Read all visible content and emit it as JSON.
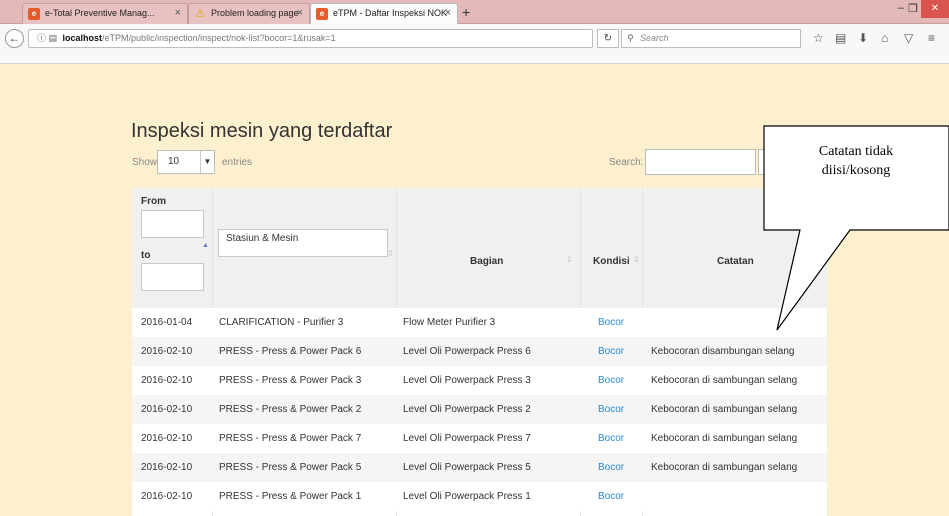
{
  "browser": {
    "tabs": [
      {
        "title": "e-Total Preventive Manag...",
        "state": "inactive",
        "favicon": "app-icon"
      },
      {
        "title": "Problem loading page",
        "state": "inactive",
        "favicon": "warning-icon"
      },
      {
        "title": "eTPM - Daftar Inspeksi NOK",
        "state": "active",
        "favicon": "app-icon"
      }
    ],
    "new_tab_label": "+",
    "tab_close_glyph": "×",
    "url_host": "localhost",
    "url_path": "/eTPM/public/inspection/inspect/nok-list?bocor=1&rusak=1",
    "search_placeholder": "Search"
  },
  "page": {
    "title": "Inspeksi mesin yang terdaftar",
    "show_label": "Show",
    "entries_value": "10",
    "entries_label": "entries",
    "search_label": "Search:"
  },
  "table": {
    "headers": {
      "from": "From",
      "to": "to",
      "stasiun_mesin": "Stasiun & Mesin",
      "bagian": "Bagian",
      "kondisi": "Kondisi",
      "catatan": "Catatan"
    },
    "rows": [
      {
        "tanggal": "2016-01-04",
        "stasiun_mesin": "CLARIFICATION - Purifier 3",
        "bagian": "Flow Meter Purifier 3",
        "kondisi": "Bocor",
        "catatan": ""
      },
      {
        "tanggal": "2016-02-10",
        "stasiun_mesin": "PRESS - Press & Power Pack 6",
        "bagian": "Level Oli Powerpack Press 6",
        "kondisi": "Bocor",
        "catatan": "Kebocoran disambungan selang"
      },
      {
        "tanggal": "2016-02-10",
        "stasiun_mesin": "PRESS - Press & Power Pack 3",
        "bagian": "Level Oli Powerpack Press 3",
        "kondisi": "Bocor",
        "catatan": "Kebocoran di sambungan selang"
      },
      {
        "tanggal": "2016-02-10",
        "stasiun_mesin": "PRESS - Press & Power Pack 2",
        "bagian": "Level Oli Powerpack Press 2",
        "kondisi": "Bocor",
        "catatan": "Kebocoran di sambungan selang"
      },
      {
        "tanggal": "2016-02-10",
        "stasiun_mesin": "PRESS - Press & Power Pack 7",
        "bagian": "Level Oli Powerpack Press 7",
        "kondisi": "Bocor",
        "catatan": "Kebocoran di sambungan selang"
      },
      {
        "tanggal": "2016-02-10",
        "stasiun_mesin": "PRESS - Press & Power Pack 5",
        "bagian": "Level Oli Powerpack Press 5",
        "kondisi": "Bocor",
        "catatan": "Kebocoran di sambungan selang"
      },
      {
        "tanggal": "2016-02-10",
        "stasiun_mesin": "PRESS - Press & Power Pack 1",
        "bagian": "Level Oli Powerpack Press 1",
        "kondisi": "Bocor",
        "catatan": ""
      }
    ]
  },
  "callout": {
    "line1": "Catatan tidak",
    "line2": "diisi/kosong"
  },
  "colors": {
    "page_background": "#fdf0cf",
    "titlebar": "#e3b8b8",
    "link_blue": "#2a8ad4",
    "close_button": "#d9534f"
  }
}
